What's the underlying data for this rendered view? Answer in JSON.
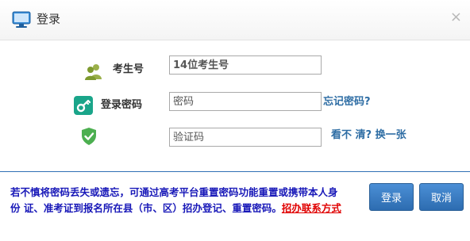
{
  "header": {
    "title": "登录",
    "close_glyph": "×",
    "icon": "monitor-icon"
  },
  "form": {
    "exam_number": {
      "label": "考生号",
      "placeholder": "14位考生号",
      "icon": "users-icon"
    },
    "password": {
      "label": "登录密码",
      "placeholder": "密码",
      "icon": "key-icon",
      "forgot_link": "忘记密码?"
    },
    "captcha": {
      "placeholder": "验证码",
      "icon": "shield-check-icon",
      "refresh_text": "看不 清? 换一张"
    }
  },
  "notice": {
    "text": "若不慎将密码丢失或遗忘，可通过高考平台重置密码功能重置或携带本人身份 证、准考证到报名所在县（市、区）招办登记、重置密码。",
    "link_text": "招办联系方式"
  },
  "buttons": {
    "login": "登录",
    "cancel": "取消"
  },
  "colors": {
    "accent": "#2e6da4",
    "notice_text": "#1818b8",
    "notice_link": "#e00000",
    "key_icon_bg": "#1aa58a",
    "shield_icon": "#4caf50"
  }
}
